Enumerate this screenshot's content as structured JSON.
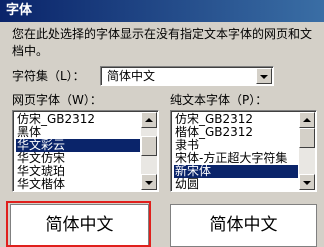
{
  "window": {
    "title": "字体"
  },
  "description": "您在此处选择的字体显示在没有指定文本字体的网页和文档中。",
  "charset": {
    "label": "字符集（L）：",
    "value": "简体中文"
  },
  "web_font": {
    "label": "网页字体（W）：",
    "items": [
      "仿宋_GB2312",
      "黑体",
      "华文彩云",
      "华文仿宋",
      "华文琥珀",
      "华文楷体"
    ],
    "selected_index": 2
  },
  "plain_font": {
    "label": "纯文本字体（P）：",
    "items": [
      "仿宋_GB2312",
      "楷体_GB2312",
      "隶书",
      "宋体-方正超大字符集",
      "新宋体",
      "幼圆"
    ],
    "selected_index": 4
  },
  "preview": {
    "left": "简体中文",
    "right": "简体中文"
  },
  "icons": [
    "dropdown-arrow-icon",
    "scroll-up-icon",
    "scroll-down-icon"
  ]
}
